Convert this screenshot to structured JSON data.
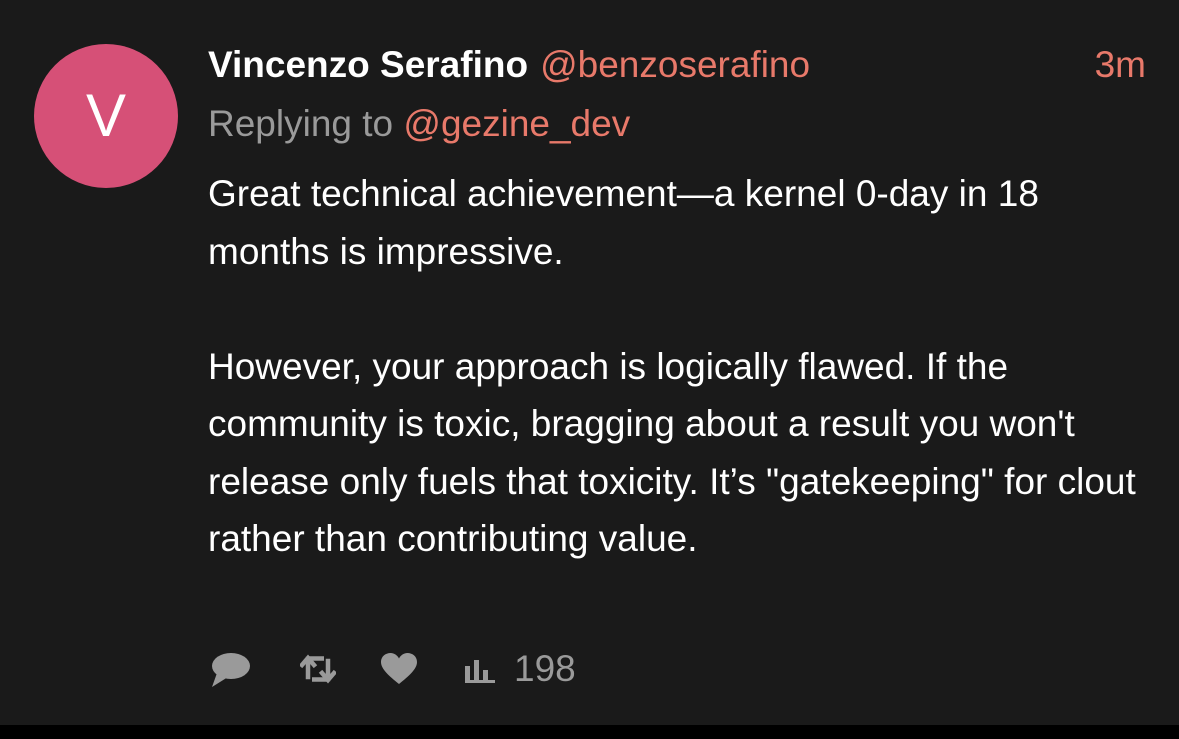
{
  "tweet": {
    "avatar_letter": "V",
    "author_name": "Vincenzo Serafino",
    "author_handle": "@benzoserafino",
    "time_ago": "3m",
    "replying_prefix": "Replying to",
    "replying_handle": "@gezine_dev",
    "paragraphs": [
      "Great technical achievement—a kernel 0-day in 18 months is impressive.",
      "However, your approach is logically flawed. If the community is toxic, bragging about a result you won't release only fuels that toxicity. It’s \"gatekeeping\" for clout rather than contributing value."
    ],
    "views_count": "198",
    "icons": [
      "reply-icon",
      "retweet-icon",
      "like-icon",
      "views-icon"
    ],
    "colors": {
      "background": "#1a1a1a",
      "avatar": "#d65077",
      "accent": "#e8796a",
      "secondary_text": "#9a9a9a"
    }
  }
}
